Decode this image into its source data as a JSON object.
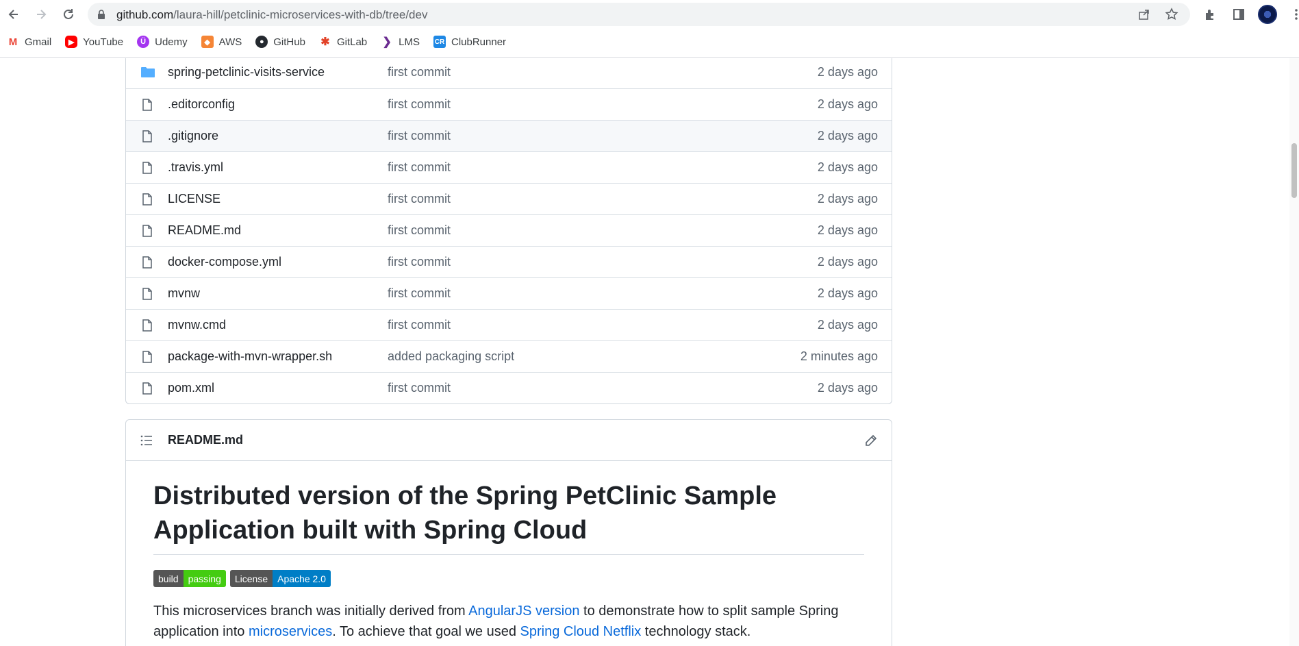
{
  "browser": {
    "url_host": "github.com",
    "url_path": "/laura-hill/petclinic-microservices-with-db/tree/dev",
    "bookmarks": [
      {
        "label": "Gmail",
        "icon": "gmail-icon",
        "color": "#ea4335"
      },
      {
        "label": "YouTube",
        "icon": "youtube-icon",
        "color": "#ff0000"
      },
      {
        "label": "Udemy",
        "icon": "udemy-icon",
        "color": "#a435f0"
      },
      {
        "label": "AWS",
        "icon": "aws-icon",
        "color": "#f58536"
      },
      {
        "label": "GitHub",
        "icon": "github-icon",
        "color": "#24292f"
      },
      {
        "label": "GitLab",
        "icon": "gitlab-icon",
        "color": "#e24329"
      },
      {
        "label": "LMS",
        "icon": "lms-icon",
        "color": "#6b2c91"
      },
      {
        "label": "ClubRunner",
        "icon": "clubrunner-icon",
        "color": "#1e88e5"
      }
    ]
  },
  "files": [
    {
      "name": "spring-petclinic-visits-service",
      "type": "folder",
      "message": "first commit",
      "age": "2 days ago"
    },
    {
      "name": ".editorconfig",
      "type": "file",
      "message": "first commit",
      "age": "2 days ago"
    },
    {
      "name": ".gitignore",
      "type": "file",
      "message": "first commit",
      "age": "2 days ago"
    },
    {
      "name": ".travis.yml",
      "type": "file",
      "message": "first commit",
      "age": "2 days ago"
    },
    {
      "name": "LICENSE",
      "type": "file",
      "message": "first commit",
      "age": "2 days ago"
    },
    {
      "name": "README.md",
      "type": "file",
      "message": "first commit",
      "age": "2 days ago"
    },
    {
      "name": "docker-compose.yml",
      "type": "file",
      "message": "first commit",
      "age": "2 days ago"
    },
    {
      "name": "mvnw",
      "type": "file",
      "message": "first commit",
      "age": "2 days ago"
    },
    {
      "name": "mvnw.cmd",
      "type": "file",
      "message": "first commit",
      "age": "2 days ago"
    },
    {
      "name": "package-with-mvn-wrapper.sh",
      "type": "file",
      "message": "added packaging script",
      "age": "2 minutes ago"
    },
    {
      "name": "pom.xml",
      "type": "file",
      "message": "first commit",
      "age": "2 days ago"
    }
  ],
  "readme": {
    "filename": "README.md",
    "heading_line1": "Distributed version of the Spring PetClinic Sample",
    "heading_line2": "Application built with Spring Cloud",
    "badges": [
      {
        "left": "build",
        "right": "passing",
        "color": "#44cc11"
      },
      {
        "left": "License",
        "right": "Apache 2.0",
        "color": "#007ec6"
      }
    ],
    "para_1": "This microservices branch was initially derived from ",
    "link_angular": "AngularJS version",
    "para_2": " to demonstrate how to split sample Spring",
    "para_3": "application into ",
    "link_micro": "microservices",
    "para_4": ". To achieve that goal we used ",
    "link_netflix": "Spring Cloud Netflix",
    "para_5": " technology stack."
  }
}
